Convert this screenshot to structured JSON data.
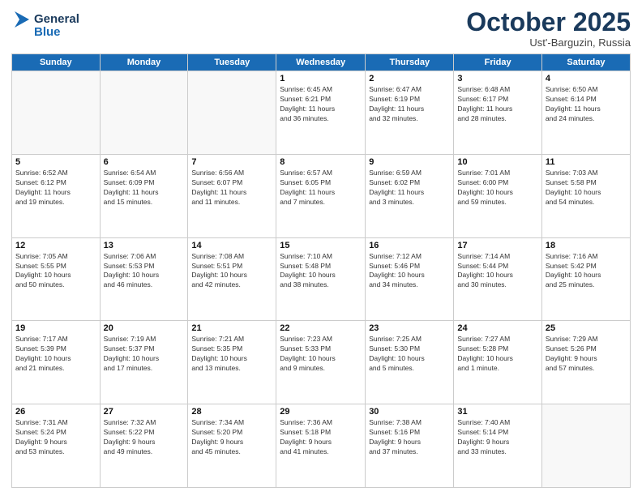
{
  "header": {
    "logo_line1": "General",
    "logo_line2": "Blue",
    "month_title": "October 2025",
    "location": "Ust'-Barguzin, Russia"
  },
  "weekdays": [
    "Sunday",
    "Monday",
    "Tuesday",
    "Wednesday",
    "Thursday",
    "Friday",
    "Saturday"
  ],
  "weeks": [
    [
      {
        "day": "",
        "info": ""
      },
      {
        "day": "",
        "info": ""
      },
      {
        "day": "",
        "info": ""
      },
      {
        "day": "1",
        "info": "Sunrise: 6:45 AM\nSunset: 6:21 PM\nDaylight: 11 hours\nand 36 minutes."
      },
      {
        "day": "2",
        "info": "Sunrise: 6:47 AM\nSunset: 6:19 PM\nDaylight: 11 hours\nand 32 minutes."
      },
      {
        "day": "3",
        "info": "Sunrise: 6:48 AM\nSunset: 6:17 PM\nDaylight: 11 hours\nand 28 minutes."
      },
      {
        "day": "4",
        "info": "Sunrise: 6:50 AM\nSunset: 6:14 PM\nDaylight: 11 hours\nand 24 minutes."
      }
    ],
    [
      {
        "day": "5",
        "info": "Sunrise: 6:52 AM\nSunset: 6:12 PM\nDaylight: 11 hours\nand 19 minutes."
      },
      {
        "day": "6",
        "info": "Sunrise: 6:54 AM\nSunset: 6:09 PM\nDaylight: 11 hours\nand 15 minutes."
      },
      {
        "day": "7",
        "info": "Sunrise: 6:56 AM\nSunset: 6:07 PM\nDaylight: 11 hours\nand 11 minutes."
      },
      {
        "day": "8",
        "info": "Sunrise: 6:57 AM\nSunset: 6:05 PM\nDaylight: 11 hours\nand 7 minutes."
      },
      {
        "day": "9",
        "info": "Sunrise: 6:59 AM\nSunset: 6:02 PM\nDaylight: 11 hours\nand 3 minutes."
      },
      {
        "day": "10",
        "info": "Sunrise: 7:01 AM\nSunset: 6:00 PM\nDaylight: 10 hours\nand 59 minutes."
      },
      {
        "day": "11",
        "info": "Sunrise: 7:03 AM\nSunset: 5:58 PM\nDaylight: 10 hours\nand 54 minutes."
      }
    ],
    [
      {
        "day": "12",
        "info": "Sunrise: 7:05 AM\nSunset: 5:55 PM\nDaylight: 10 hours\nand 50 minutes."
      },
      {
        "day": "13",
        "info": "Sunrise: 7:06 AM\nSunset: 5:53 PM\nDaylight: 10 hours\nand 46 minutes."
      },
      {
        "day": "14",
        "info": "Sunrise: 7:08 AM\nSunset: 5:51 PM\nDaylight: 10 hours\nand 42 minutes."
      },
      {
        "day": "15",
        "info": "Sunrise: 7:10 AM\nSunset: 5:48 PM\nDaylight: 10 hours\nand 38 minutes."
      },
      {
        "day": "16",
        "info": "Sunrise: 7:12 AM\nSunset: 5:46 PM\nDaylight: 10 hours\nand 34 minutes."
      },
      {
        "day": "17",
        "info": "Sunrise: 7:14 AM\nSunset: 5:44 PM\nDaylight: 10 hours\nand 30 minutes."
      },
      {
        "day": "18",
        "info": "Sunrise: 7:16 AM\nSunset: 5:42 PM\nDaylight: 10 hours\nand 25 minutes."
      }
    ],
    [
      {
        "day": "19",
        "info": "Sunrise: 7:17 AM\nSunset: 5:39 PM\nDaylight: 10 hours\nand 21 minutes."
      },
      {
        "day": "20",
        "info": "Sunrise: 7:19 AM\nSunset: 5:37 PM\nDaylight: 10 hours\nand 17 minutes."
      },
      {
        "day": "21",
        "info": "Sunrise: 7:21 AM\nSunset: 5:35 PM\nDaylight: 10 hours\nand 13 minutes."
      },
      {
        "day": "22",
        "info": "Sunrise: 7:23 AM\nSunset: 5:33 PM\nDaylight: 10 hours\nand 9 minutes."
      },
      {
        "day": "23",
        "info": "Sunrise: 7:25 AM\nSunset: 5:30 PM\nDaylight: 10 hours\nand 5 minutes."
      },
      {
        "day": "24",
        "info": "Sunrise: 7:27 AM\nSunset: 5:28 PM\nDaylight: 10 hours\nand 1 minute."
      },
      {
        "day": "25",
        "info": "Sunrise: 7:29 AM\nSunset: 5:26 PM\nDaylight: 9 hours\nand 57 minutes."
      }
    ],
    [
      {
        "day": "26",
        "info": "Sunrise: 7:31 AM\nSunset: 5:24 PM\nDaylight: 9 hours\nand 53 minutes."
      },
      {
        "day": "27",
        "info": "Sunrise: 7:32 AM\nSunset: 5:22 PM\nDaylight: 9 hours\nand 49 minutes."
      },
      {
        "day": "28",
        "info": "Sunrise: 7:34 AM\nSunset: 5:20 PM\nDaylight: 9 hours\nand 45 minutes."
      },
      {
        "day": "29",
        "info": "Sunrise: 7:36 AM\nSunset: 5:18 PM\nDaylight: 9 hours\nand 41 minutes."
      },
      {
        "day": "30",
        "info": "Sunrise: 7:38 AM\nSunset: 5:16 PM\nDaylight: 9 hours\nand 37 minutes."
      },
      {
        "day": "31",
        "info": "Sunrise: 7:40 AM\nSunset: 5:14 PM\nDaylight: 9 hours\nand 33 minutes."
      },
      {
        "day": "",
        "info": ""
      }
    ]
  ]
}
